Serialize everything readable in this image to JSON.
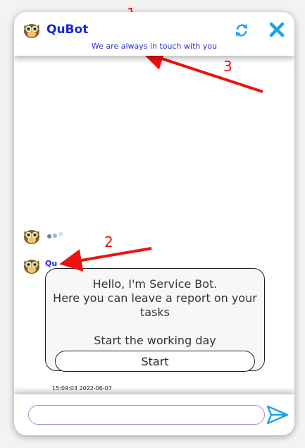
{
  "header": {
    "title": "QuBot",
    "subtitle": "We are always in touch with you"
  },
  "message": {
    "sender": "Qu",
    "lines": [
      "Hello, I'm Service Bot.",
      "Here you can leave a report on your",
      "tasks",
      "Start the working day"
    ],
    "button_label": "Start",
    "timestamp": "15:09:03 2022-06-07"
  },
  "input": {
    "value": "",
    "placeholder": ""
  },
  "icons": {
    "avatar": "owl-icon",
    "refresh": "refresh-icon",
    "close": "close-icon",
    "send": "send-icon"
  },
  "colors": {
    "brand_blue": "#1a23d6",
    "accent_cyan": "#1aa3e8",
    "input_border": "#a98ad6"
  },
  "annotations": [
    "1",
    "2",
    "3"
  ]
}
